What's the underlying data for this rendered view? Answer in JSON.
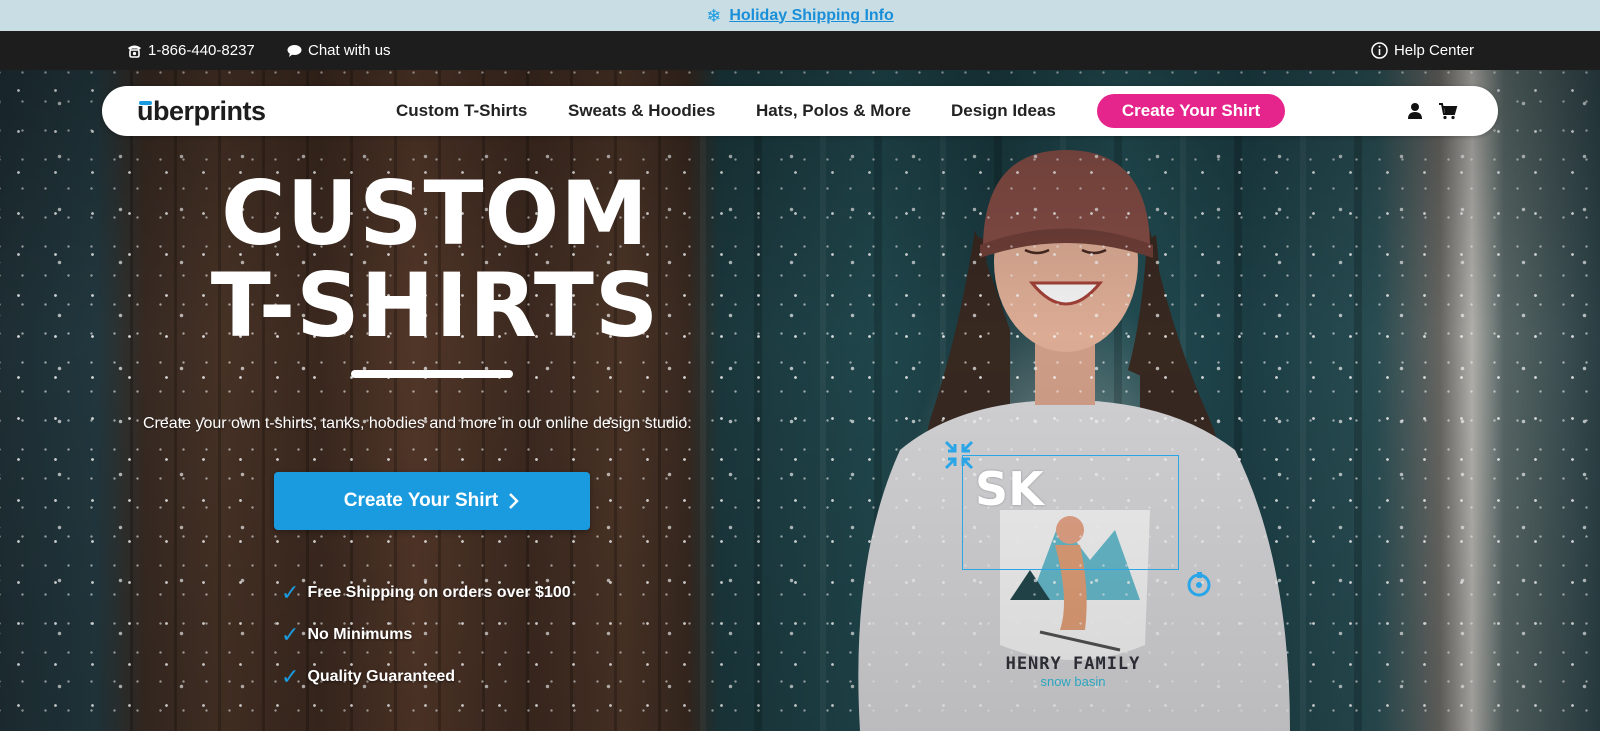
{
  "promo": {
    "text": "Holiday Shipping Info"
  },
  "utility": {
    "phone": "1-866-440-8237",
    "chat": "Chat with us",
    "help": "Help Center"
  },
  "nav": {
    "logo": "uberprints",
    "links": [
      "Custom T-Shirts",
      "Sweats & Hoodies",
      "Hats, Polos & More",
      "Design Ideas"
    ],
    "cta": "Create Your Shirt"
  },
  "hero": {
    "title_line1": "CUSTOM",
    "title_line2": "T-SHIRTS",
    "subtitle": "Create your own t-shirts, tanks, hoodies and more in our online design studio.",
    "cta": "Create Your Shirt",
    "benefits": [
      "Free Shipping on orders over $100",
      "No Minimums",
      "Quality Guaranteed"
    ],
    "shirt_print": {
      "top": "SK",
      "line1": "HENRY FAMILY",
      "line2": "snow basin"
    }
  },
  "colors": {
    "accent_blue": "#1a9be0",
    "brand_pink": "#e6258c",
    "utility_bg": "#1d1d1d",
    "promo_bg": "#c9dde5"
  },
  "icons": [
    "snowflake-icon",
    "phone-icon",
    "chat-icon",
    "info-icon",
    "user-icon",
    "cart-icon",
    "chevron-right-icon",
    "checkmark-icon",
    "rotate-handle-icon",
    "resize-handle-icon"
  ]
}
